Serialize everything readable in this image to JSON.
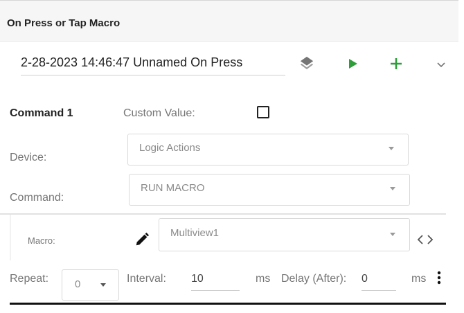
{
  "header": {
    "title": "On Press or Tap Macro"
  },
  "macro": {
    "name": "2-28-2023 14:46:47 Unnamed On Press"
  },
  "toolbar": {
    "layers_icon": "layers-icon",
    "play_icon": "play-icon",
    "add_icon": "plus-icon",
    "expand_icon": "chevron-down-icon",
    "play_color": "#2e9e3a",
    "add_color": "#2e9e3a"
  },
  "command": {
    "title": "Command 1",
    "custom_value_label": "Custom Value:",
    "custom_value_checked": false,
    "device_label": "Device:",
    "device_value": "Logic Actions",
    "command_label": "Command:",
    "command_value": "RUN MACRO",
    "macro_label": "Macro:",
    "macro_value": "Multiview1",
    "repeat_label": "Repeat:",
    "repeat_value": "0",
    "interval_label": "Interval:",
    "interval_value": "10",
    "interval_unit": "ms",
    "delay_label": "Delay (After):",
    "delay_value": "0",
    "delay_unit": "ms"
  }
}
